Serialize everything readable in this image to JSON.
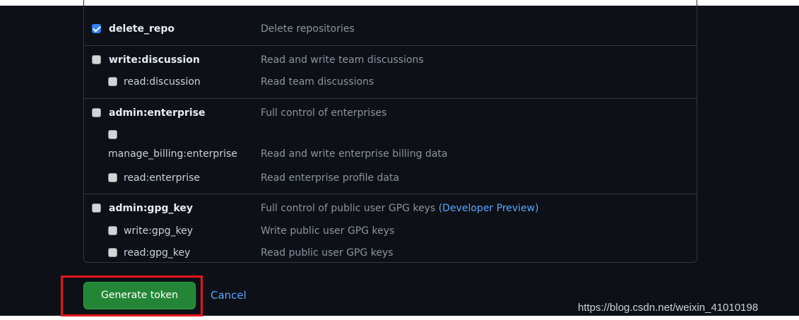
{
  "colors": {
    "background": "#0d1117",
    "border": "#30363d",
    "text_primary": "#e6edf3",
    "text_muted": "#8b949e",
    "link": "#58a6ff",
    "checkbox_checked": "#2f81f7",
    "button_green": "#238636",
    "highlight_red": "#e8141c"
  },
  "scopes": {
    "delete_repo": {
      "name": "delete_repo",
      "description": "Delete repositories",
      "checked": true
    },
    "write_discussion": {
      "name": "write:discussion",
      "description": "Read and write team discussions",
      "checked": false
    },
    "read_discussion": {
      "name": "read:discussion",
      "description": "Read team discussions",
      "checked": false
    },
    "admin_enterprise": {
      "name": "admin:enterprise",
      "description": "Full control of enterprises",
      "checked": false
    },
    "manage_billing_enterprise": {
      "name": "manage_billing:enterprise",
      "description": "Read and write enterprise billing data",
      "checked": false
    },
    "read_enterprise": {
      "name": "read:enterprise",
      "description": "Read enterprise profile data",
      "checked": false
    },
    "admin_gpg_key": {
      "name": "admin:gpg_key",
      "description": "Full control of public user GPG keys",
      "description_link": "(Developer Preview)",
      "checked": false
    },
    "write_gpg_key": {
      "name": "write:gpg_key",
      "description": "Write public user GPG keys",
      "checked": false
    },
    "read_gpg_key": {
      "name": "read:gpg_key",
      "description": "Read public user GPG keys",
      "checked": false
    }
  },
  "actions": {
    "generate_label": "Generate token",
    "cancel_label": "Cancel"
  },
  "watermark": "https://blog.csdn.net/weixin_41010198"
}
